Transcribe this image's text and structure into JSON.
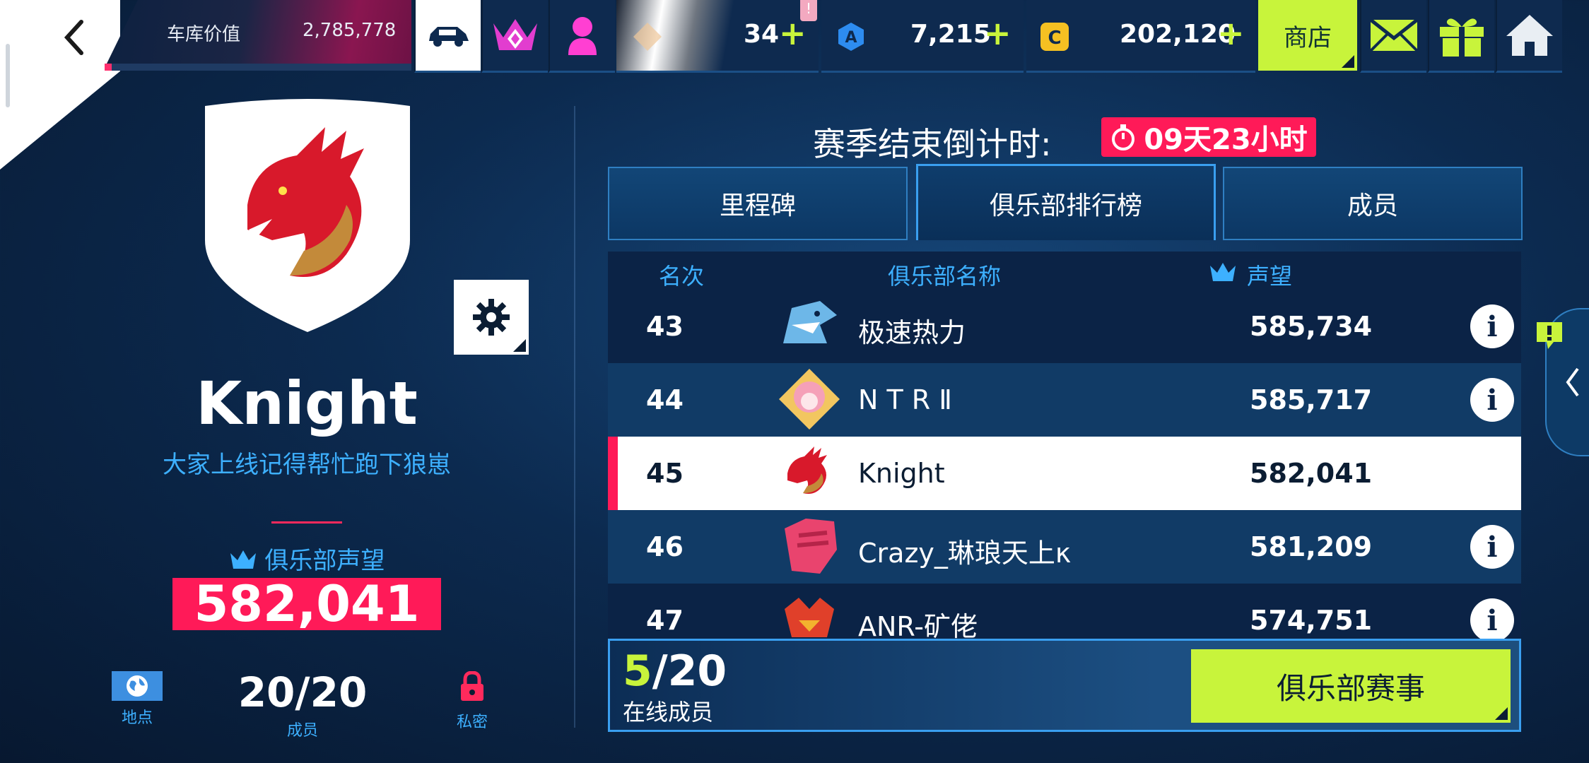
{
  "topbar": {
    "garage_label": "车库价值",
    "garage_value": "2,785,778",
    "token_count": "34",
    "token_alert": "!",
    "blueprints_count": "7,215",
    "credits_count": "202,120",
    "plus_symbol": "+",
    "shop_label": "商店"
  },
  "club": {
    "name": "Knight",
    "motto": "大家上线记得帮忙跑下狼崽",
    "prestige_label": "俱乐部声望",
    "prestige_value": "582,041",
    "location_label": "地点",
    "members_value": "20/20",
    "members_label": "成员",
    "privacy_label": "私密"
  },
  "season": {
    "countdown_label": "赛季结束倒计时:",
    "countdown_value": "09天23小时"
  },
  "tabs": [
    "里程碑",
    "俱乐部排行榜",
    "成员"
  ],
  "leaderboard": {
    "headers": {
      "rank": "名次",
      "name": "俱乐部名称",
      "prestige": "声望"
    },
    "rows": [
      {
        "rank": "43",
        "name": "极速热力",
        "score": "585,734"
      },
      {
        "rank": "44",
        "name": "N T R Ⅱ",
        "score": "585,717"
      },
      {
        "rank": "45",
        "name": "Knight",
        "score": "582,041"
      },
      {
        "rank": "46",
        "name": "Crazy_琳琅天上κ",
        "score": "581,209"
      },
      {
        "rank": "47",
        "name": "ANR-矿佬",
        "score": "574,751"
      }
    ],
    "info_symbol": "i"
  },
  "footer": {
    "online_now": "5",
    "online_total": "/20",
    "online_label": "在线成员",
    "events_button": "俱乐部赛事"
  },
  "colors": {
    "accent_green": "#c8f43b",
    "accent_pink": "#ff1a58",
    "accent_blue": "#3db0ff"
  }
}
